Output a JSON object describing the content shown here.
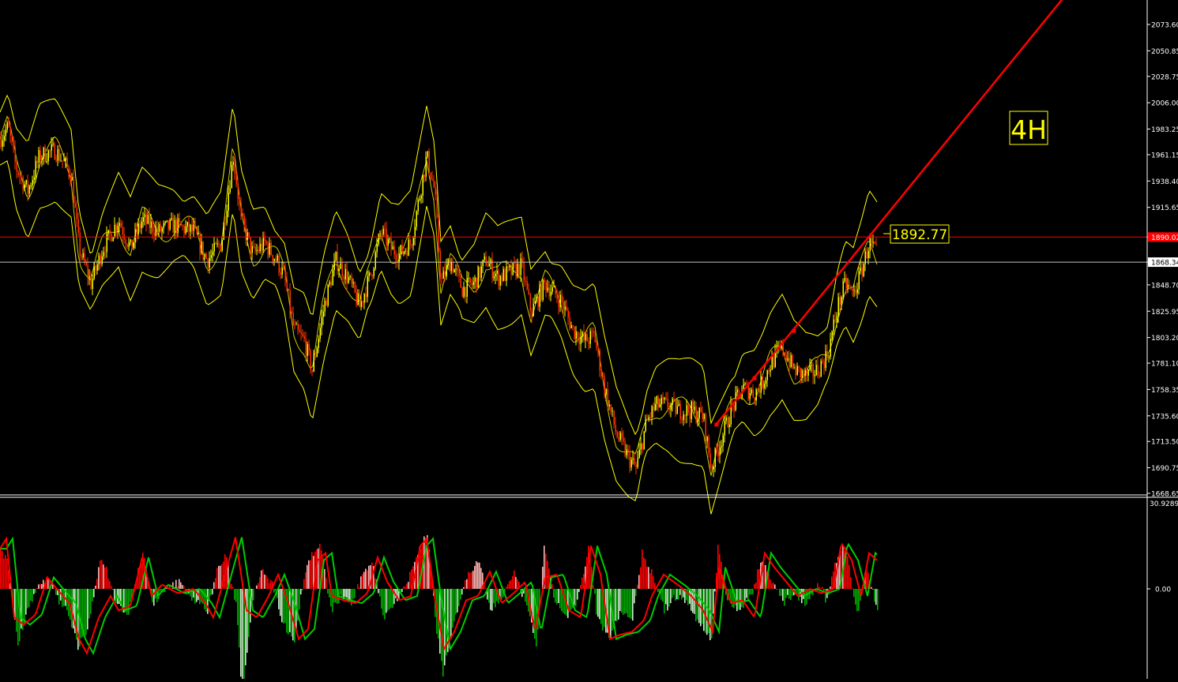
{
  "timeframe_label": "4H",
  "colors": {
    "background": "#000000",
    "axis_text": "#ffffff",
    "bands": "#ffff00",
    "candle_bull": "#ffff00",
    "candle_bear": "#ff3300",
    "trendline": "#ff0000",
    "resistance_line": "#ff0000",
    "current_price_line": "#c0c0c0",
    "macd_line": "#ff0000",
    "signal_line": "#00cc00",
    "hist_pos": "#ff0000",
    "hist_pos_light": "#ffb6b6",
    "hist_neg": "#00aa00",
    "hist_neg_light": "#c8f0c8",
    "label_yellow": "#ffff00"
  },
  "chart_data": [
    {
      "type": "candlestick",
      "panel": "price",
      "y_ticks": [
        "2073.60",
        "2050.85",
        "2028.75",
        "2006.00",
        "1983.25",
        "1961.15",
        "1938.40",
        "1915.65",
        "1890.02",
        "1868.34",
        "1848.70",
        "1825.95",
        "1803.20",
        "1781.10",
        "1758.35",
        "1735.60",
        "1713.50",
        "1690.75",
        "1668.65"
      ],
      "ylim": [
        1668.65,
        2073.6
      ],
      "resistance_level": 1890.02,
      "resistance_label": "1890.02",
      "current_price": 1868.34,
      "current_price_label": "1868.34",
      "trendline_label": "1892.77",
      "trendline": [
        {
          "bar": 905,
          "price": 1727
        },
        {
          "bar": 1350,
          "price": 2100
        }
      ],
      "trendline_markers": [
        {
          "bar": 907,
          "price": 1728
        },
        {
          "bar": 955,
          "price": 1768
        },
        {
          "bar": 1005,
          "price": 1809
        }
      ],
      "close_path": [
        [
          0,
          1975
        ],
        [
          10,
          1985
        ],
        [
          20,
          1950
        ],
        [
          35,
          1930
        ],
        [
          50,
          1960
        ],
        [
          70,
          1965
        ],
        [
          90,
          1945
        ],
        [
          100,
          1880
        ],
        [
          115,
          1850
        ],
        [
          130,
          1880
        ],
        [
          150,
          1905
        ],
        [
          165,
          1880
        ],
        [
          180,
          1905
        ],
        [
          200,
          1895
        ],
        [
          220,
          1900
        ],
        [
          245,
          1895
        ],
        [
          262,
          1870
        ],
        [
          280,
          1885
        ],
        [
          295,
          1960
        ],
        [
          305,
          1905
        ],
        [
          320,
          1875
        ],
        [
          335,
          1885
        ],
        [
          350,
          1870
        ],
        [
          360,
          1855
        ],
        [
          372,
          1810
        ],
        [
          385,
          1800
        ],
        [
          395,
          1775
        ],
        [
          410,
          1830
        ],
        [
          425,
          1870
        ],
        [
          440,
          1855
        ],
        [
          455,
          1830
        ],
        [
          470,
          1860
        ],
        [
          482,
          1895
        ],
        [
          495,
          1880
        ],
        [
          505,
          1875
        ],
        [
          520,
          1885
        ],
        [
          532,
          1930
        ],
        [
          540,
          1960
        ],
        [
          550,
          1930
        ],
        [
          558,
          1850
        ],
        [
          570,
          1870
        ],
        [
          585,
          1845
        ],
        [
          600,
          1850
        ],
        [
          615,
          1870
        ],
        [
          630,
          1855
        ],
        [
          648,
          1860
        ],
        [
          660,
          1865
        ],
        [
          672,
          1825
        ],
        [
          690,
          1850
        ],
        [
          710,
          1835
        ],
        [
          725,
          1810
        ],
        [
          740,
          1800
        ],
        [
          752,
          1805
        ],
        [
          765,
          1760
        ],
        [
          780,
          1720
        ],
        [
          795,
          1700
        ],
        [
          805,
          1690
        ],
        [
          818,
          1730
        ],
        [
          830,
          1745
        ],
        [
          845,
          1745
        ],
        [
          860,
          1740
        ],
        [
          875,
          1740
        ],
        [
          890,
          1735
        ],
        [
          900,
          1690
        ],
        [
          910,
          1710
        ],
        [
          925,
          1740
        ],
        [
          940,
          1760
        ],
        [
          955,
          1755
        ],
        [
          965,
          1765
        ],
        [
          975,
          1780
        ],
        [
          990,
          1795
        ],
        [
          1005,
          1775
        ],
        [
          1020,
          1770
        ],
        [
          1035,
          1775
        ],
        [
          1048,
          1790
        ],
        [
          1060,
          1830
        ],
        [
          1070,
          1850
        ],
        [
          1080,
          1840
        ],
        [
          1090,
          1860
        ],
        [
          1100,
          1885
        ],
        [
          1110,
          1875
        ]
      ],
      "band_half_width": 38
    },
    {
      "type": "line",
      "panel": "oscillator",
      "y_ticks": [
        "30.9289",
        "0.00"
      ],
      "ylim": [
        -54,
        54
      ],
      "zero_label": "0.00",
      "max_label": "30.9289",
      "macd_path": [
        [
          0,
          28
        ],
        [
          8,
          35
        ],
        [
          18,
          -20
        ],
        [
          30,
          -25
        ],
        [
          45,
          -18
        ],
        [
          60,
          8
        ],
        [
          75,
          -2
        ],
        [
          88,
          -10
        ],
        [
          100,
          -35
        ],
        [
          110,
          -45
        ],
        [
          125,
          -20
        ],
        [
          140,
          -5
        ],
        [
          150,
          -15
        ],
        [
          165,
          -12
        ],
        [
          180,
          22
        ],
        [
          192,
          -5
        ],
        [
          205,
          3
        ],
        [
          225,
          -3
        ],
        [
          245,
          0
        ],
        [
          260,
          -10
        ],
        [
          270,
          -20
        ],
        [
          285,
          10
        ],
        [
          298,
          36
        ],
        [
          312,
          -15
        ],
        [
          325,
          -20
        ],
        [
          340,
          -5
        ],
        [
          352,
          10
        ],
        [
          365,
          -10
        ],
        [
          378,
          -35
        ],
        [
          390,
          -28
        ],
        [
          402,
          20
        ],
        [
          412,
          25
        ],
        [
          420,
          -5
        ],
        [
          435,
          -8
        ],
        [
          450,
          -10
        ],
        [
          465,
          -3
        ],
        [
          478,
          22
        ],
        [
          490,
          5
        ],
        [
          505,
          -8
        ],
        [
          520,
          -5
        ],
        [
          532,
          30
        ],
        [
          540,
          35
        ],
        [
          550,
          -5
        ],
        [
          562,
          -42
        ],
        [
          575,
          -30
        ],
        [
          590,
          -8
        ],
        [
          605,
          -5
        ],
        [
          620,
          12
        ],
        [
          635,
          -10
        ],
        [
          650,
          -3
        ],
        [
          665,
          5
        ],
        [
          677,
          -30
        ],
        [
          690,
          8
        ],
        [
          705,
          10
        ],
        [
          720,
          -15
        ],
        [
          735,
          -20
        ],
        [
          748,
          30
        ],
        [
          760,
          10
        ],
        [
          772,
          -35
        ],
        [
          785,
          -32
        ],
        [
          800,
          -30
        ],
        [
          815,
          -22
        ],
        [
          825,
          -5
        ],
        [
          840,
          10
        ],
        [
          860,
          2
        ],
        [
          875,
          -5
        ],
        [
          890,
          -15
        ],
        [
          902,
          -30
        ],
        [
          910,
          15
        ],
        [
          925,
          -10
        ],
        [
          940,
          -8
        ],
        [
          955,
          -20
        ],
        [
          968,
          25
        ],
        [
          980,
          15
        ],
        [
          995,
          5
        ],
        [
          1010,
          -5
        ],
        [
          1025,
          0
        ],
        [
          1040,
          -3
        ],
        [
          1055,
          0
        ],
        [
          1065,
          32
        ],
        [
          1078,
          20
        ],
        [
          1090,
          -5
        ],
        [
          1100,
          25
        ],
        [
          1110,
          20
        ]
      ],
      "histogram_path": [
        [
          0,
          25
        ],
        [
          8,
          22
        ],
        [
          14,
          -5
        ],
        [
          22,
          -38
        ],
        [
          35,
          -12
        ],
        [
          50,
          3
        ],
        [
          62,
          6
        ],
        [
          75,
          -10
        ],
        [
          85,
          -15
        ],
        [
          98,
          -40
        ],
        [
          110,
          -30
        ],
        [
          125,
          20
        ],
        [
          135,
          12
        ],
        [
          145,
          -8
        ],
        [
          160,
          -20
        ],
        [
          172,
          8
        ],
        [
          180,
          25
        ],
        [
          192,
          -10
        ],
        [
          205,
          -3
        ],
        [
          225,
          5
        ],
        [
          245,
          -8
        ],
        [
          262,
          -15
        ],
        [
          275,
          15
        ],
        [
          285,
          22
        ],
        [
          298,
          -10
        ],
        [
          306,
          -75
        ],
        [
          318,
          -10
        ],
        [
          330,
          15
        ],
        [
          345,
          2
        ],
        [
          358,
          -25
        ],
        [
          372,
          -35
        ],
        [
          385,
          12
        ],
        [
          395,
          25
        ],
        [
          405,
          30
        ],
        [
          418,
          -15
        ],
        [
          432,
          -5
        ],
        [
          445,
          -10
        ],
        [
          460,
          12
        ],
        [
          470,
          20
        ],
        [
          485,
          -20
        ],
        [
          500,
          -8
        ],
        [
          515,
          5
        ],
        [
          528,
          25
        ],
        [
          540,
          40
        ],
        [
          552,
          -30
        ],
        [
          560,
          -60
        ],
        [
          575,
          -20
        ],
        [
          590,
          8
        ],
        [
          605,
          20
        ],
        [
          620,
          -15
        ],
        [
          635,
          -5
        ],
        [
          650,
          10
        ],
        [
          665,
          -10
        ],
        [
          678,
          -40
        ],
        [
          688,
          28
        ],
        [
          700,
          -5
        ],
        [
          715,
          -20
        ],
        [
          730,
          -10
        ],
        [
          745,
          30
        ],
        [
          755,
          -20
        ],
        [
          770,
          -35
        ],
        [
          785,
          -15
        ],
        [
          800,
          -20
        ],
        [
          812,
          25
        ],
        [
          825,
          10
        ],
        [
          840,
          -15
        ],
        [
          855,
          -5
        ],
        [
          870,
          -10
        ],
        [
          885,
          -25
        ],
        [
          900,
          -35
        ],
        [
          908,
          30
        ],
        [
          920,
          -8
        ],
        [
          935,
          -15
        ],
        [
          950,
          -5
        ],
        [
          962,
          20
        ],
        [
          975,
          8
        ],
        [
          990,
          -10
        ],
        [
          1005,
          -3
        ],
        [
          1020,
          -10
        ],
        [
          1035,
          5
        ],
        [
          1045,
          -8
        ],
        [
          1060,
          25
        ],
        [
          1070,
          30
        ],
        [
          1085,
          -20
        ],
        [
          1095,
          15
        ],
        [
          1110,
          -15
        ]
      ]
    }
  ]
}
